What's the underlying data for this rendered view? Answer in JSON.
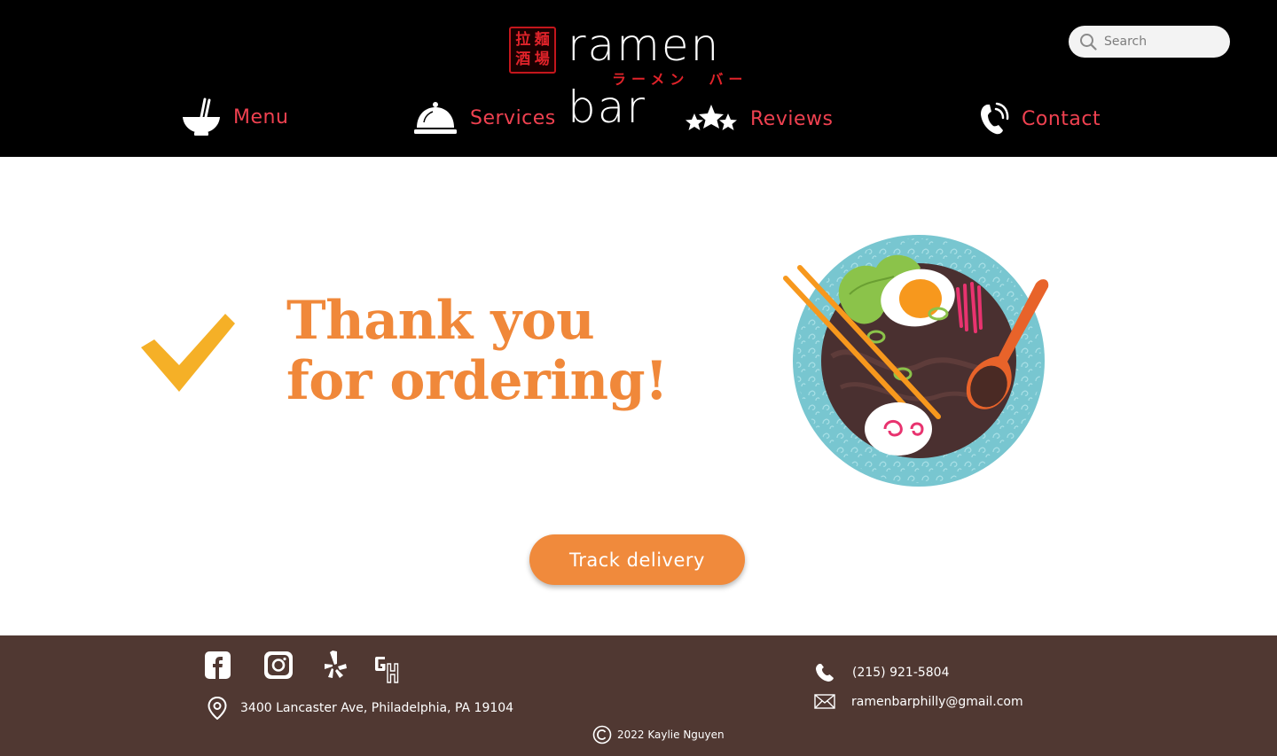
{
  "header": {
    "logo": {
      "stamp_chars": [
        "拉",
        "麺",
        "酒",
        "場"
      ],
      "name": "ramen bar",
      "kana": "ラーメン　バー"
    },
    "search": {
      "placeholder": "Search",
      "value": ""
    },
    "nav": {
      "menu": "Menu",
      "services": "Services",
      "reviews": "Reviews",
      "contact": "Contact"
    }
  },
  "main": {
    "thanks_line1": "Thank you",
    "thanks_line2": "for ordering!",
    "track_button": "Track delivery"
  },
  "footer": {
    "social": [
      "facebook-icon",
      "instagram-icon",
      "yelp-icon",
      "grubhub-icon"
    ],
    "address": "3400 Lancaster Ave, Philadelphia, PA 19104",
    "phone": "(215) 921-5804",
    "email": "ramenbarphilly@gmail.com",
    "copyright": "2022 Kaylie Nguyen"
  },
  "colors": {
    "header_bg": "#000000",
    "nav_text": "#ef4150",
    "headline": "#f0883a",
    "checkmark": "#f5b027",
    "button": "#f08a3c",
    "footer_bg": "#503832"
  }
}
